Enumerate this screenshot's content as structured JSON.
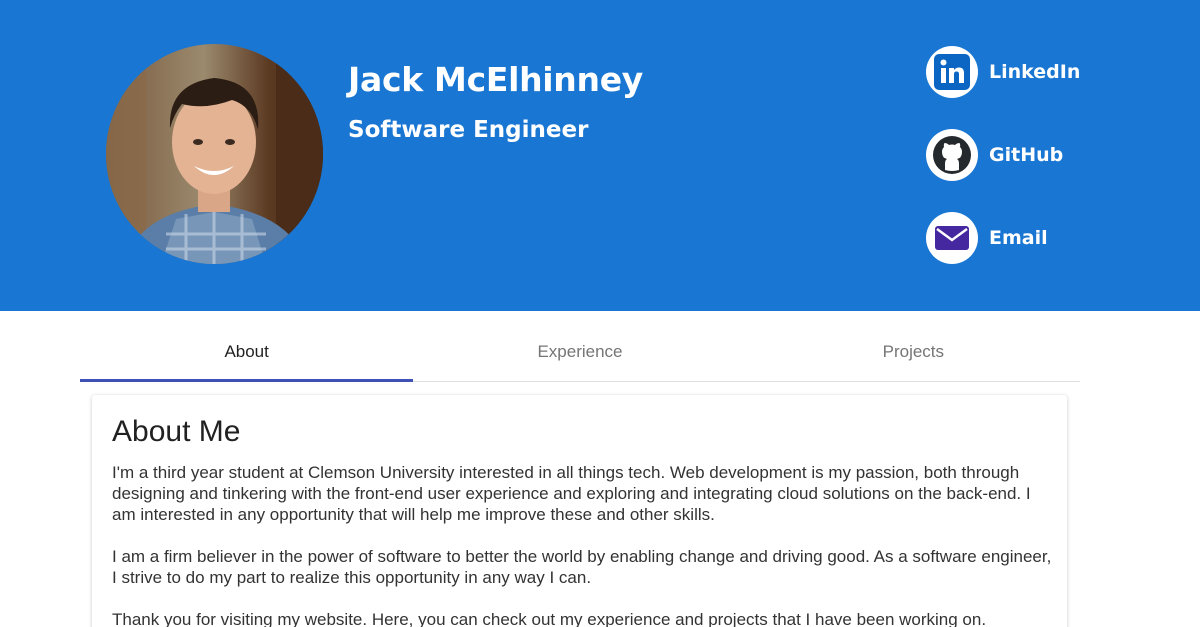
{
  "header": {
    "name": "Jack McElhinney",
    "title": "Software Engineer",
    "bg_color": "#1976d2",
    "social": [
      {
        "label": "LinkedIn",
        "icon": "linkedin-icon",
        "color": "#0a66c2"
      },
      {
        "label": "GitHub",
        "icon": "github-icon",
        "color": "#24292e"
      },
      {
        "label": "Email",
        "icon": "envelope-icon",
        "color": "#4527a0"
      }
    ]
  },
  "tabs": {
    "items": [
      "About",
      "Experience",
      "Projects"
    ],
    "active": "About",
    "indicator_color": "#3f51b5"
  },
  "about": {
    "heading": "About Me",
    "paragraphs": [
      "I'm a third year student at Clemson University interested in all things tech. Web development is my passion, both through designing and tinkering with the front-end user experience and exploring and integrating cloud solutions on the back-end. I am interested in any opportunity that will help me improve these and other skills.",
      "I am a firm believer in the power of software to better the world by enabling change and driving good. As a software engineer, I strive to do my part to realize this opportunity in any way I can.",
      "Thank you for visiting my website. Here, you can check out my experience and projects that I have been working on."
    ]
  }
}
